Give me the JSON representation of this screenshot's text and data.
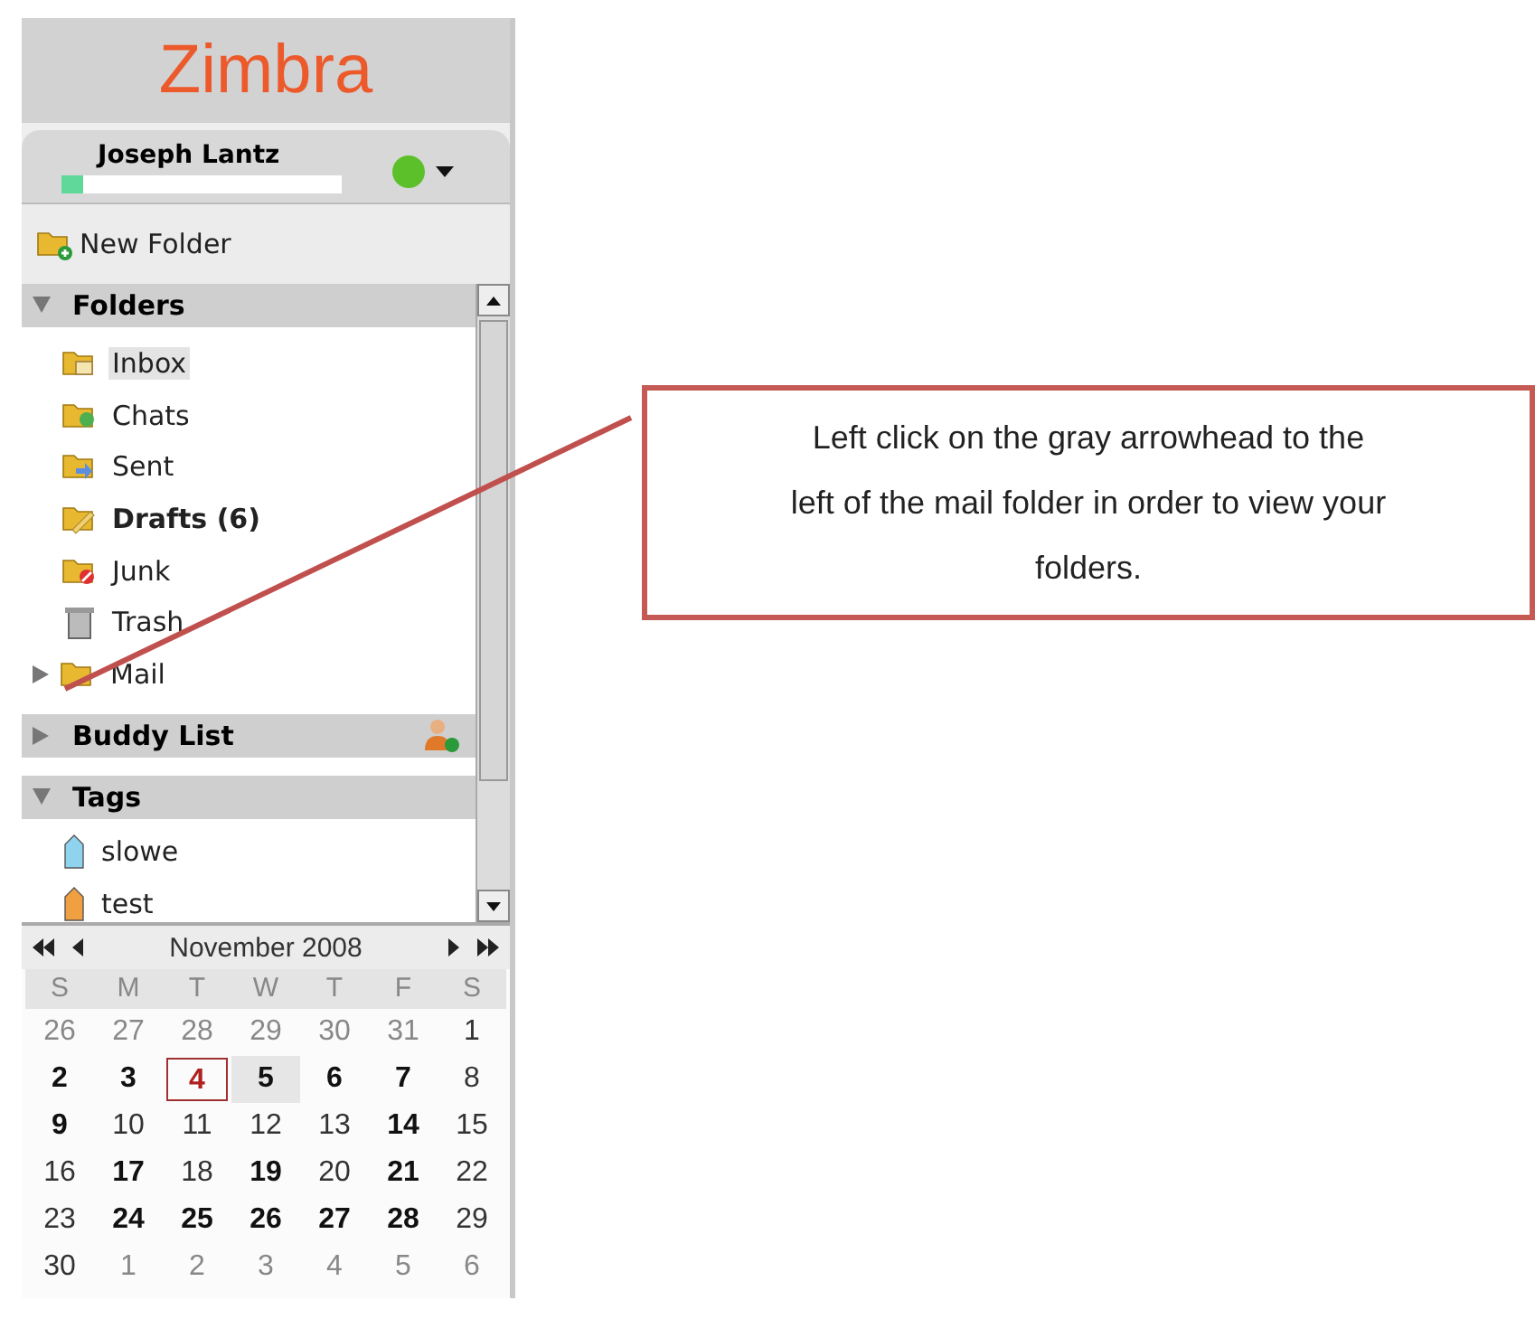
{
  "logo": "Zimbra",
  "user": {
    "name": "Joseph Lantz",
    "quota": {
      "level": 0.08
    },
    "online": true
  },
  "new_folder": "New Folder",
  "folders": {
    "title": "Folders",
    "expanded": true,
    "items": [
      {
        "label": "Inbox",
        "kind": "inbox",
        "selected": true,
        "unread": false
      },
      {
        "label": "Chats",
        "kind": "chats",
        "selected": false,
        "unread": false
      },
      {
        "label": "Sent",
        "kind": "sent",
        "selected": false,
        "unread": false
      },
      {
        "label": "Drafts (6)",
        "kind": "drafts",
        "selected": false,
        "unread": true
      },
      {
        "label": "Junk",
        "kind": "junk",
        "selected": false,
        "unread": false
      },
      {
        "label": "Trash",
        "kind": "trash",
        "selected": false,
        "unread": false
      },
      {
        "label": "Mail",
        "kind": "folder",
        "selected": false,
        "unread": false,
        "expanded": false
      }
    ]
  },
  "buddy_list": {
    "title": "Buddy List",
    "expanded": false
  },
  "tags": {
    "title": "Tags",
    "expanded": true,
    "items": [
      {
        "label": "slowe",
        "color": "#8fd3ee"
      },
      {
        "label": "test",
        "color": "#f0a040"
      }
    ]
  },
  "calendar": {
    "month": "November 2008",
    "weekdays": [
      "S",
      "M",
      "T",
      "W",
      "T",
      "F",
      "S"
    ],
    "days": [
      {
        "day": "26",
        "other_month": true,
        "bold": false,
        "today": false,
        "selected": false
      },
      {
        "day": "27",
        "other_month": true,
        "bold": false,
        "today": false,
        "selected": false
      },
      {
        "day": "28",
        "other_month": true,
        "bold": false,
        "today": false,
        "selected": false
      },
      {
        "day": "29",
        "other_month": true,
        "bold": false,
        "today": false,
        "selected": false
      },
      {
        "day": "30",
        "other_month": true,
        "bold": false,
        "today": false,
        "selected": false
      },
      {
        "day": "31",
        "other_month": true,
        "bold": false,
        "today": false,
        "selected": false
      },
      {
        "day": "1",
        "other_month": false,
        "bold": false,
        "today": false,
        "selected": false
      },
      {
        "day": "2",
        "other_month": false,
        "bold": true,
        "today": false,
        "selected": false
      },
      {
        "day": "3",
        "other_month": false,
        "bold": true,
        "today": false,
        "selected": false
      },
      {
        "day": "4",
        "other_month": false,
        "bold": true,
        "today": true,
        "selected": false
      },
      {
        "day": "5",
        "other_month": false,
        "bold": true,
        "today": false,
        "selected": true
      },
      {
        "day": "6",
        "other_month": false,
        "bold": true,
        "today": false,
        "selected": false
      },
      {
        "day": "7",
        "other_month": false,
        "bold": true,
        "today": false,
        "selected": false
      },
      {
        "day": "8",
        "other_month": false,
        "bold": false,
        "today": false,
        "selected": false
      },
      {
        "day": "9",
        "other_month": false,
        "bold": true,
        "today": false,
        "selected": false
      },
      {
        "day": "10",
        "other_month": false,
        "bold": false,
        "today": false,
        "selected": false
      },
      {
        "day": "11",
        "other_month": false,
        "bold": false,
        "today": false,
        "selected": false
      },
      {
        "day": "12",
        "other_month": false,
        "bold": false,
        "today": false,
        "selected": false
      },
      {
        "day": "13",
        "other_month": false,
        "bold": false,
        "today": false,
        "selected": false
      },
      {
        "day": "14",
        "other_month": false,
        "bold": true,
        "today": false,
        "selected": false
      },
      {
        "day": "15",
        "other_month": false,
        "bold": false,
        "today": false,
        "selected": false
      },
      {
        "day": "16",
        "other_month": false,
        "bold": false,
        "today": false,
        "selected": false
      },
      {
        "day": "17",
        "other_month": false,
        "bold": true,
        "today": false,
        "selected": false
      },
      {
        "day": "18",
        "other_month": false,
        "bold": false,
        "today": false,
        "selected": false
      },
      {
        "day": "19",
        "other_month": false,
        "bold": true,
        "today": false,
        "selected": false
      },
      {
        "day": "20",
        "other_month": false,
        "bold": false,
        "today": false,
        "selected": false
      },
      {
        "day": "21",
        "other_month": false,
        "bold": true,
        "today": false,
        "selected": false
      },
      {
        "day": "22",
        "other_month": false,
        "bold": false,
        "today": false,
        "selected": false
      },
      {
        "day": "23",
        "other_month": false,
        "bold": false,
        "today": false,
        "selected": false
      },
      {
        "day": "24",
        "other_month": false,
        "bold": true,
        "today": false,
        "selected": false
      },
      {
        "day": "25",
        "other_month": false,
        "bold": true,
        "today": false,
        "selected": false
      },
      {
        "day": "26",
        "other_month": false,
        "bold": true,
        "today": false,
        "selected": false
      },
      {
        "day": "27",
        "other_month": false,
        "bold": true,
        "today": false,
        "selected": false
      },
      {
        "day": "28",
        "other_month": false,
        "bold": true,
        "today": false,
        "selected": false
      },
      {
        "day": "29",
        "other_month": false,
        "bold": false,
        "today": false,
        "selected": false
      },
      {
        "day": "30",
        "other_month": false,
        "bold": false,
        "today": false,
        "selected": false
      },
      {
        "day": "1",
        "other_month": true,
        "bold": false,
        "today": false,
        "selected": false
      },
      {
        "day": "2",
        "other_month": true,
        "bold": false,
        "today": false,
        "selected": false
      },
      {
        "day": "3",
        "other_month": true,
        "bold": false,
        "today": false,
        "selected": false
      },
      {
        "day": "4",
        "other_month": true,
        "bold": false,
        "today": false,
        "selected": false
      },
      {
        "day": "5",
        "other_month": true,
        "bold": false,
        "today": false,
        "selected": false
      },
      {
        "day": "6",
        "other_month": true,
        "bold": false,
        "today": false,
        "selected": false
      }
    ]
  },
  "callout": {
    "text": "Left click on the gray arrowhead to the left of the mail folder in order to view your folders."
  }
}
